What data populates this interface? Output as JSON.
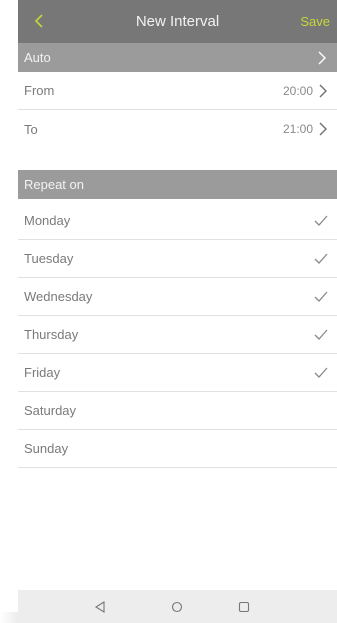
{
  "header": {
    "title": "New Interval",
    "save_label": "Save",
    "back_icon": "chevron-left-icon"
  },
  "auto": {
    "label": "Auto",
    "chevron_icon": "chevron-right-icon"
  },
  "from": {
    "label": "From",
    "value": "20:00"
  },
  "to": {
    "label": "To",
    "value": "21:00"
  },
  "repeat_on": {
    "label": "Repeat on"
  },
  "days": [
    {
      "label": "Monday",
      "checked": true
    },
    {
      "label": "Tuesday",
      "checked": true
    },
    {
      "label": "Wednesday",
      "checked": true
    },
    {
      "label": "Thursday",
      "checked": true
    },
    {
      "label": "Friday",
      "checked": true
    },
    {
      "label": "Saturday",
      "checked": false
    },
    {
      "label": "Sunday",
      "checked": false
    }
  ],
  "nav": {
    "back_icon": "triangle-back-icon",
    "home_icon": "circle-home-icon",
    "recents_icon": "square-recents-icon"
  },
  "colors": {
    "header_bg": "#777777",
    "section_bg": "#9b9b9b",
    "accent": "#c6d63a",
    "text": "#7a7a7a"
  }
}
